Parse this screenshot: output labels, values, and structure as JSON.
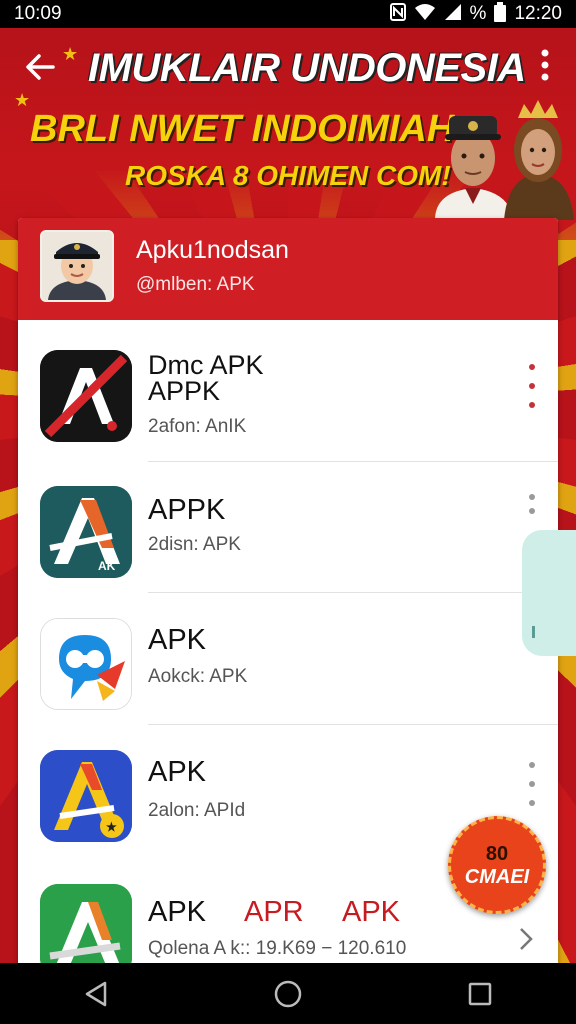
{
  "status_bar": {
    "time_left": "10:09",
    "percent": "%",
    "time_right": "12:20"
  },
  "header": {
    "title_line1": "IMUKLAIR UNDONESIA",
    "title_line2": "BRLI NWET INDOIMIAH",
    "title_line3": "ROSKA 8 OHIMEN COM!"
  },
  "profile": {
    "name": "Apku1nodsan",
    "handle": "@mlben: APK"
  },
  "apps": [
    {
      "title_line1": "Dmc APK",
      "title_line2": "APPK",
      "subtitle": "2afon: AnIK"
    },
    {
      "title": "APPK",
      "subtitle": "2disn: APK"
    },
    {
      "title": "APK",
      "subtitle": "Aokck: APK"
    },
    {
      "title": "APK",
      "subtitle": "2alon: APId"
    },
    {
      "title": "APK",
      "extra1": "APR",
      "extra2": "APK",
      "subtitle": "Qolena A k:: 19.K69 − 120.610"
    }
  ],
  "badge": {
    "number": "80",
    "text": "CMAEI"
  },
  "colors": {
    "brand_red": "#cf1f25",
    "banner_yellow": "#f5d20c",
    "badge_orange": "#e8431b"
  },
  "icons": [
    "back-arrow-icon",
    "more-vert-icon",
    "wifi-icon",
    "signal-icon",
    "battery-icon",
    "nav-back-icon",
    "nav-home-icon",
    "nav-recents-icon",
    "chevron-right-icon"
  ]
}
